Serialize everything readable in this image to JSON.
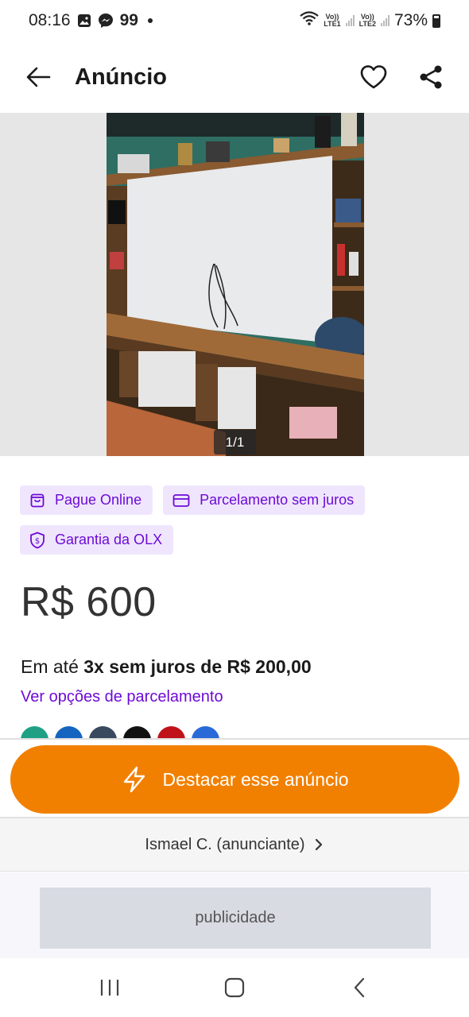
{
  "status_bar": {
    "time": "08:16",
    "notification_count": "99",
    "sim1_label_top": "Vo))",
    "sim1_label_bottom": "LTE1",
    "sim2_label_top": "Vo))",
    "sim2_label_bottom": "LTE2",
    "battery": "73%"
  },
  "app_bar": {
    "title": "Anúncio",
    "icons": [
      "back-arrow-icon",
      "heart-icon",
      "share-icon"
    ]
  },
  "gallery": {
    "counter": "1/1"
  },
  "badges": [
    {
      "label": "Pague Online",
      "icon": "shopping-bag-icon"
    },
    {
      "label": "Parcelamento sem juros",
      "icon": "credit-card-icon"
    },
    {
      "label": "Garantia da OLX",
      "icon": "shield-dollar-icon"
    }
  ],
  "price": "R$ 600",
  "installments": {
    "prefix": "Em até ",
    "highlight": "3x sem juros de R$ 200,00",
    "link": "Ver opções de parcelamento"
  },
  "cta": {
    "label": "Destacar esse anúncio",
    "icon": "lightning-icon"
  },
  "seller": {
    "label": "Ismael C. (anunciante)"
  },
  "ad": {
    "label": "publicidade"
  },
  "colors": {
    "accent_purple": "#6e0ad6",
    "badge_bg": "#efe6fd",
    "cta_orange": "#f28000"
  }
}
